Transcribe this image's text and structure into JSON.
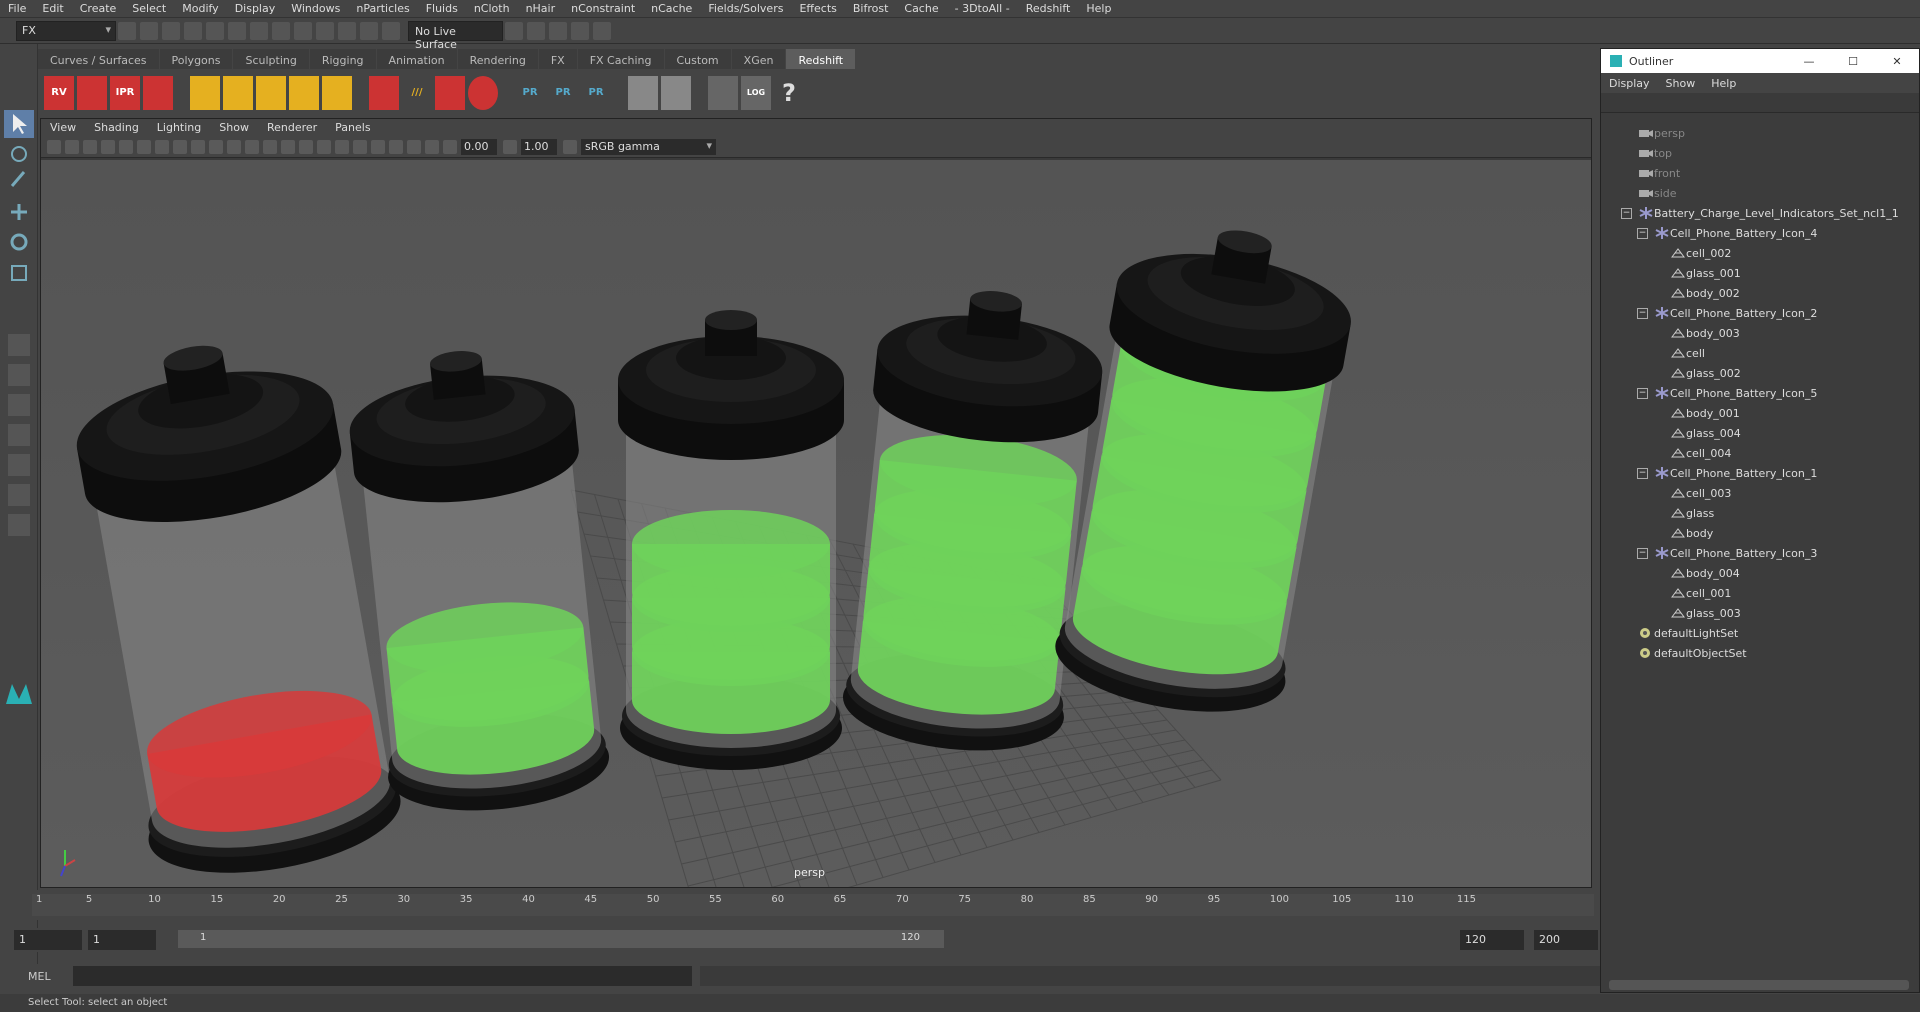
{
  "menu": [
    "File",
    "Edit",
    "Create",
    "Select",
    "Modify",
    "Display",
    "Windows",
    "nParticles",
    "Fluids",
    "nCloth",
    "nHair",
    "nConstraint",
    "nCache",
    "Fields/Solvers",
    "Effects",
    "Bifrost",
    "Cache",
    "- 3DtoAll -",
    "Redshift",
    "Help"
  ],
  "status": {
    "mode": "FX",
    "live_surface": "No Live Surface"
  },
  "shelf_tabs": [
    "Curves / Surfaces",
    "Polygons",
    "Sculpting",
    "Rigging",
    "Animation",
    "Rendering",
    "FX",
    "FX Caching",
    "Custom",
    "XGen",
    "Redshift"
  ],
  "shelf_active": "Redshift",
  "shelf_icons": [
    "RV",
    "",
    "IPR",
    "",
    "PR",
    "PR",
    "PR",
    "LOG",
    "?"
  ],
  "viewport": {
    "menu": [
      "View",
      "Shading",
      "Lighting",
      "Show",
      "Renderer",
      "Panels"
    ],
    "exposure": "0.00",
    "gamma": "1.00",
    "colorspace": "sRGB gamma",
    "camera": "persp"
  },
  "timeline": {
    "ticks": [
      "1",
      "5",
      "10",
      "15",
      "20",
      "25",
      "30",
      "35",
      "40",
      "45",
      "50",
      "55",
      "60",
      "65",
      "70",
      "75",
      "80",
      "85",
      "90",
      "95",
      "100",
      "105",
      "110",
      "115"
    ]
  },
  "range": {
    "start": "1",
    "cur": "1",
    "bar_start": "1",
    "bar_end": "120",
    "end": "120",
    "max": "200"
  },
  "mel_label": "MEL",
  "help_text": "Select Tool: select an object",
  "outliner": {
    "title": "Outliner",
    "menu": [
      "Display",
      "Show",
      "Help"
    ],
    "items": [
      {
        "label": "persp",
        "depth": 0,
        "icon": "camera",
        "dim": true
      },
      {
        "label": "top",
        "depth": 0,
        "icon": "camera",
        "dim": true
      },
      {
        "label": "front",
        "depth": 0,
        "icon": "camera",
        "dim": true
      },
      {
        "label": "side",
        "depth": 0,
        "icon": "camera",
        "dim": true
      },
      {
        "label": "Battery_Charge_Level_Indicators_Set_ncl1_1",
        "depth": 0,
        "icon": "group",
        "exp": "−"
      },
      {
        "label": "Cell_Phone_Battery_Icon_4",
        "depth": 1,
        "icon": "group",
        "exp": "−"
      },
      {
        "label": "cell_002",
        "depth": 2,
        "icon": "mesh"
      },
      {
        "label": "glass_001",
        "depth": 2,
        "icon": "mesh"
      },
      {
        "label": "body_002",
        "depth": 2,
        "icon": "mesh"
      },
      {
        "label": "Cell_Phone_Battery_Icon_2",
        "depth": 1,
        "icon": "group",
        "exp": "−"
      },
      {
        "label": "body_003",
        "depth": 2,
        "icon": "mesh"
      },
      {
        "label": "cell",
        "depth": 2,
        "icon": "mesh"
      },
      {
        "label": "glass_002",
        "depth": 2,
        "icon": "mesh"
      },
      {
        "label": "Cell_Phone_Battery_Icon_5",
        "depth": 1,
        "icon": "group",
        "exp": "−"
      },
      {
        "label": "body_001",
        "depth": 2,
        "icon": "mesh"
      },
      {
        "label": "glass_004",
        "depth": 2,
        "icon": "mesh"
      },
      {
        "label": "cell_004",
        "depth": 2,
        "icon": "mesh"
      },
      {
        "label": "Cell_Phone_Battery_Icon_1",
        "depth": 1,
        "icon": "group",
        "exp": "−"
      },
      {
        "label": "cell_003",
        "depth": 2,
        "icon": "mesh"
      },
      {
        "label": "glass",
        "depth": 2,
        "icon": "mesh"
      },
      {
        "label": "body",
        "depth": 2,
        "icon": "mesh"
      },
      {
        "label": "Cell_Phone_Battery_Icon_3",
        "depth": 1,
        "icon": "group",
        "exp": "−"
      },
      {
        "label": "body_004",
        "depth": 2,
        "icon": "mesh"
      },
      {
        "label": "cell_001",
        "depth": 2,
        "icon": "mesh"
      },
      {
        "label": "glass_003",
        "depth": 2,
        "icon": "mesh"
      },
      {
        "label": "defaultLightSet",
        "depth": 0,
        "icon": "set"
      },
      {
        "label": "defaultObjectSet",
        "depth": 0,
        "icon": "set"
      }
    ]
  },
  "batteries": [
    {
      "levels": 1,
      "color": "#d83a3a"
    },
    {
      "levels": 2,
      "color": "#6fd25a"
    },
    {
      "levels": 3,
      "color": "#6fd25a"
    },
    {
      "levels": 4,
      "color": "#6fd25a"
    },
    {
      "levels": 5,
      "color": "#6fd25a"
    }
  ]
}
